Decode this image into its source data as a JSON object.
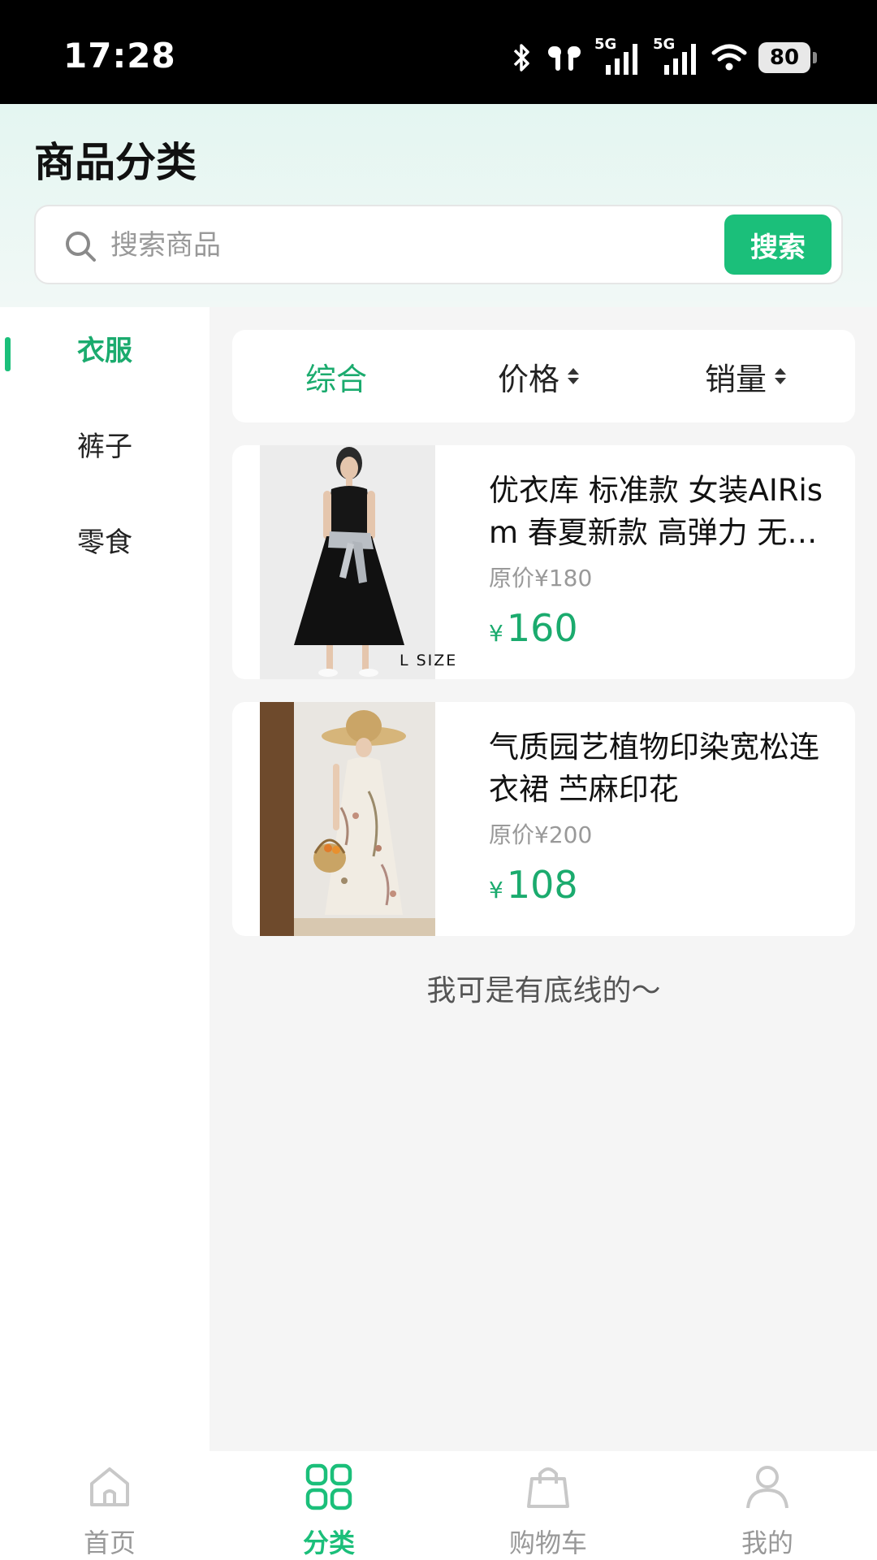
{
  "status_bar": {
    "time": "17:28",
    "network_1": "5G",
    "network_2": "5G",
    "battery": "80"
  },
  "header": {
    "title": "商品分类"
  },
  "search": {
    "placeholder": "搜索商品",
    "button_label": "搜索"
  },
  "categories": [
    {
      "label": "衣服",
      "active": true
    },
    {
      "label": "裤子",
      "active": false
    },
    {
      "label": "零食",
      "active": false
    }
  ],
  "sort": {
    "tabs": [
      {
        "label": "综合",
        "active": true
      },
      {
        "label": "价格",
        "active": false
      },
      {
        "label": "销量",
        "active": false
      }
    ]
  },
  "products": [
    {
      "name": "优衣库 标准款 女装AIRism 春夏新款 高弹力 无袖连衣裙",
      "original_price": "原价¥180",
      "currency": "¥",
      "price": "160",
      "image_caption": "L SIZE"
    },
    {
      "name": "气质园艺植物印染宽松连衣裙 苎麻印花",
      "original_price": "原价¥200",
      "currency": "¥",
      "price": "108"
    }
  ],
  "list_end": "我可是有底线的～",
  "bottom_nav": [
    {
      "label": "首页",
      "icon": "home-icon",
      "active": false
    },
    {
      "label": "分类",
      "icon": "category-icon",
      "active": true
    },
    {
      "label": "购物车",
      "icon": "cart-icon",
      "active": false
    },
    {
      "label": "我的",
      "icon": "profile-icon",
      "active": false
    }
  ],
  "colors": {
    "accent": "#1bbf7a",
    "accent_text": "#1bab6e",
    "background": "#f5f5f5"
  }
}
